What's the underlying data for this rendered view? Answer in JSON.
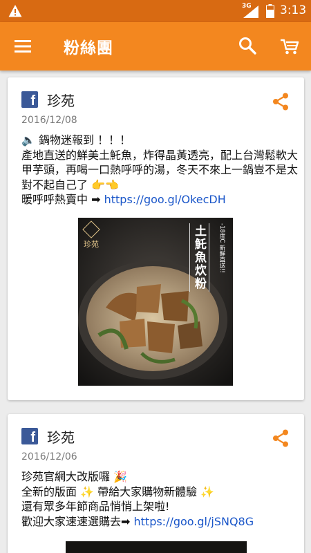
{
  "status_bar": {
    "network": "3G",
    "time": "3:13"
  },
  "app_bar": {
    "title": "粉絲團"
  },
  "posts": [
    {
      "author": "珍苑",
      "date": "2016/12/08",
      "lines": [
        "🔈 鍋物迷報到 ！！！",
        "產地直送的鮮美土魠魚，炸得晶黃透亮，配上台灣鬆軟大甲芋頭，再喝一口熱呼呼的湯，冬天不來上一鍋豈不是太對不起自己了 ",
        "暖呼呼熱賣中 ➡ "
      ],
      "hands": "👉👈",
      "link": "https://goo.gl/OkecDH",
      "image": {
        "brand": "珍苑",
        "title": "土魠魚炊粉",
        "subtitle": "-18度C 新鮮直送!!"
      }
    },
    {
      "author": "珍苑",
      "date": "2016/12/06",
      "lines": [
        "珍苑官網大改版囉 🎉",
        "全新的版面 ✨ 帶給大家購物新體驗 ✨",
        "還有眾多年節商品悄悄上架啦!",
        "歡迎大家速速選購去➡ "
      ],
      "link": "https://goo.gl/jSNQ8G"
    }
  ],
  "colors": {
    "status_bar": "#d86a12",
    "app_bar": "#f3871f",
    "accent": "#f3871f",
    "link": "#1a56c9",
    "facebook": "#3b5998"
  },
  "icons": [
    "warning-icon",
    "signal-icon",
    "battery-icon",
    "menu-icon",
    "search-icon",
    "cart-icon",
    "facebook-icon",
    "share-icon"
  ]
}
